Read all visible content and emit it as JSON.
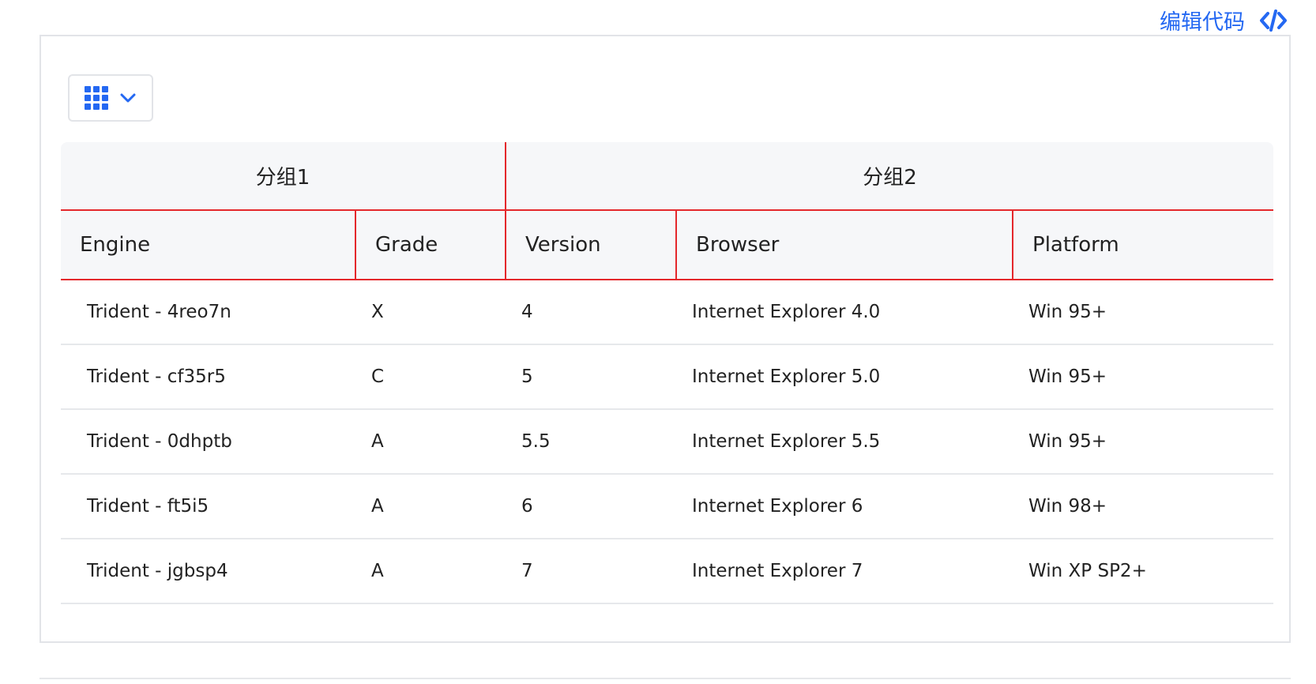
{
  "edit_link": {
    "label": "编辑代码",
    "icon": "code-icon",
    "color": "#2468f2"
  },
  "toolbar": {
    "columns_button_icon": "grid-icon",
    "dropdown_icon": "chevron-down-icon"
  },
  "table": {
    "header_groups": [
      {
        "label": "分组1"
      },
      {
        "label": "分组2"
      }
    ],
    "columns": [
      "Engine",
      "Grade",
      "Version",
      "Browser",
      "Platform"
    ],
    "rows": [
      [
        "Trident - 4reo7n",
        "X",
        "4",
        "Internet Explorer 4.0",
        "Win 95+"
      ],
      [
        "Trident - cf35r5",
        "C",
        "5",
        "Internet Explorer 5.0",
        "Win 95+"
      ],
      [
        "Trident - 0dhptb",
        "A",
        "5.5",
        "Internet Explorer 5.5",
        "Win 95+"
      ],
      [
        "Trident - ft5i5",
        "A",
        "6",
        "Internet Explorer 6",
        "Win 98+"
      ],
      [
        "Trident - jgbsp4",
        "A",
        "7",
        "Internet Explorer 7",
        "Win XP SP2+"
      ]
    ]
  },
  "colors": {
    "accent": "#2468f2",
    "header_border": "#e4282c",
    "header_bg": "#f6f7f9"
  }
}
